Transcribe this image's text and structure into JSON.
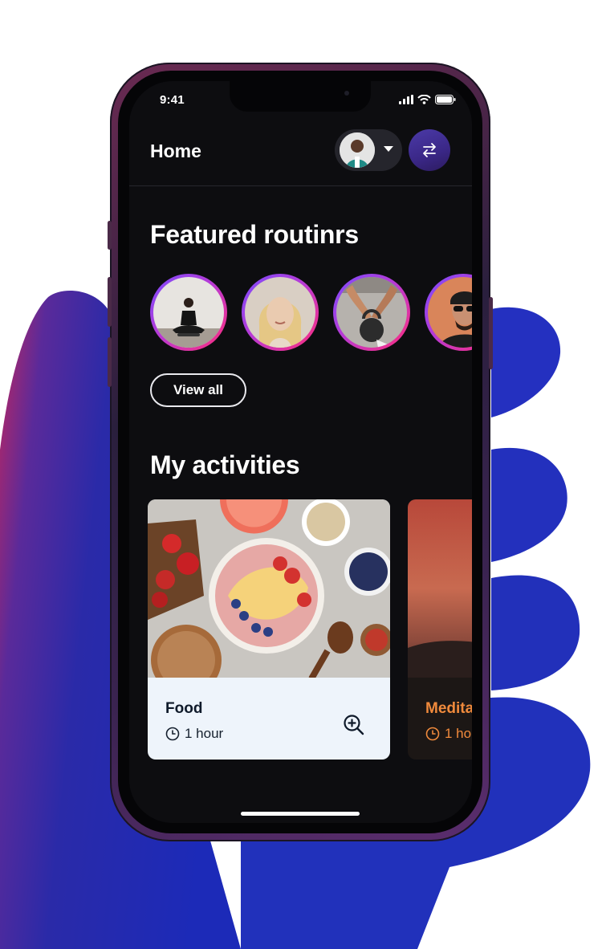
{
  "status_bar": {
    "time": "9:41"
  },
  "header": {
    "title": "Home"
  },
  "featured": {
    "title": "Featured routinrs",
    "routines": [
      {
        "name": "yoga"
      },
      {
        "name": "portrait"
      },
      {
        "name": "kettlebell"
      },
      {
        "name": "portrait-sunglasses"
      }
    ],
    "view_all_label": "View all"
  },
  "activities": {
    "title": "My activities",
    "cards": [
      {
        "title": "Food",
        "duration": "1 hour"
      },
      {
        "title": "Medita",
        "duration": "1 ho"
      }
    ]
  },
  "colors": {
    "screen_bg": "#0d0d10",
    "accent_gradient_start": "#7a4cff",
    "accent_gradient_end": "#ff2d7a",
    "meditation_text": "#f08a3c",
    "food_card_bg": "#eef4fb"
  }
}
